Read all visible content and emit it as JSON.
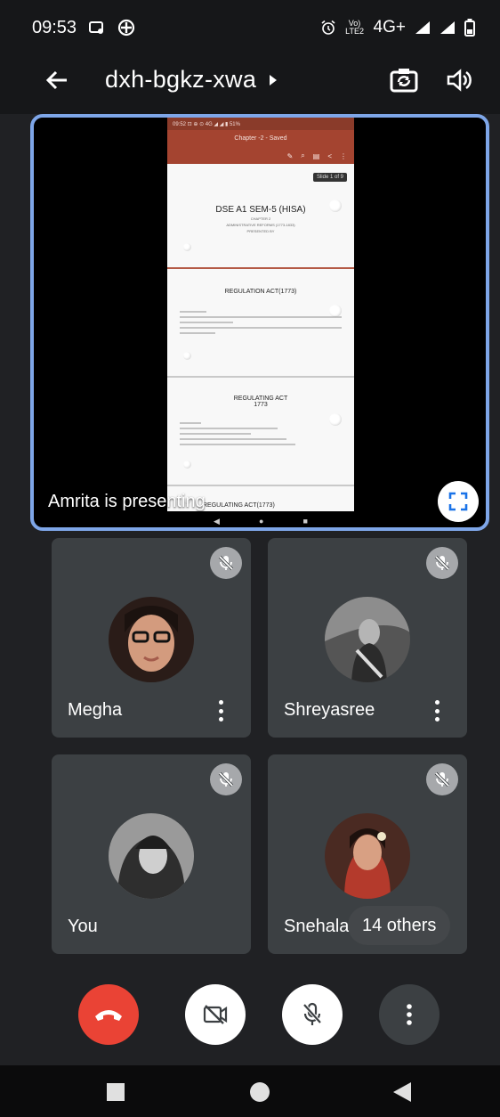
{
  "status_bar": {
    "time": "09:53",
    "left_icons": [
      "cast-icon",
      "gamepad-icon"
    ],
    "network": "4G+",
    "right_icons": [
      "alarm-icon",
      "volte-icon",
      "signal-icon",
      "signal-icon",
      "battery-icon"
    ]
  },
  "header": {
    "meeting_code": "dxh-bgkz-xwa",
    "back_icon": "arrow-back-icon",
    "expand_icon": "caret-right-icon",
    "switch_camera_icon": "switch-camera-icon",
    "speaker_icon": "speaker-icon"
  },
  "presentation": {
    "label": "Amrita is presenting",
    "shared_screen": {
      "phone_status": "09:52 ⊡ ⊕        ⊙ 4G ◢ ◢ ▮ 51%",
      "doc_title": "Chapter -2 - Saved",
      "slide_counter": "Slide 1 of 9",
      "slide1_title": "DSE A1 SEM-5 (HISA)",
      "slide1_sub1": "CHAPTER 2",
      "slide1_sub2": "ADMINISTRATIVE REFORMS (1773-1833)",
      "slide1_sub3": "PRESENTED BY",
      "slide2_title": "REGULATION ACT(1773)",
      "slide3_title": "REGULATING ACT",
      "slide3_year": "1773",
      "slide4_title": "REGULATING ACT(1773)"
    },
    "fullscreen_icon": "fullscreen-icon"
  },
  "participants": [
    {
      "name": "Megha",
      "muted": true,
      "has_menu": true,
      "avatar_color": "#6b4a3a"
    },
    {
      "name": "Shreyasree",
      "muted": true,
      "has_menu": true,
      "avatar_color": "#7a7a7a"
    },
    {
      "name": "You",
      "muted": true,
      "has_menu": false,
      "avatar_color": "#8a8a8a"
    },
    {
      "name": "Snehalata",
      "muted": true,
      "has_menu": false,
      "avatar_color": "#9a4a3a"
    }
  ],
  "others_chip": "14 others",
  "controls": {
    "end_call_icon": "end-call-icon",
    "camera_icon": "camera-off-icon",
    "mic_icon": "mic-off-icon",
    "more_icon": "more-vert-icon"
  },
  "colors": {
    "end_call": "#ea4335",
    "presentation_border": "#7ea6e8",
    "tile_bg": "#3c4043",
    "background": "#202124"
  }
}
